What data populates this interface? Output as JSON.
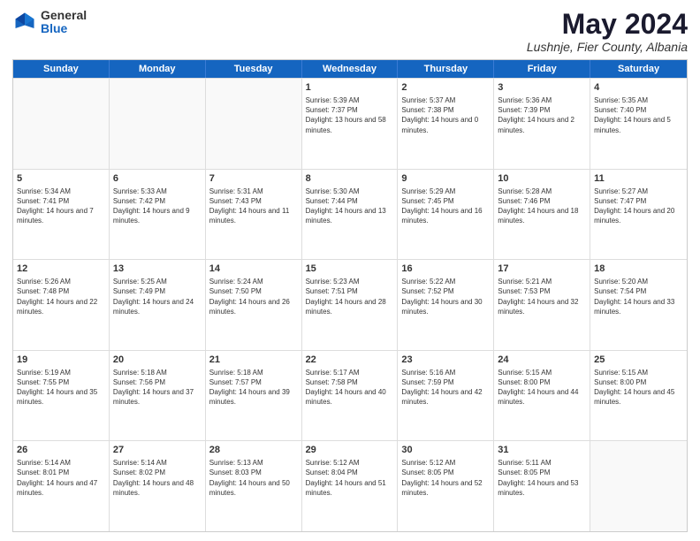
{
  "header": {
    "logo_line1": "General",
    "logo_line2": "Blue",
    "month_title": "May 2024",
    "location": "Lushnje, Fier County, Albania"
  },
  "weekdays": [
    "Sunday",
    "Monday",
    "Tuesday",
    "Wednesday",
    "Thursday",
    "Friday",
    "Saturday"
  ],
  "weeks": [
    [
      {
        "day": "",
        "empty": true
      },
      {
        "day": "",
        "empty": true
      },
      {
        "day": "",
        "empty": true
      },
      {
        "day": "1",
        "sunrise": "Sunrise: 5:39 AM",
        "sunset": "Sunset: 7:37 PM",
        "daylight": "Daylight: 13 hours and 58 minutes."
      },
      {
        "day": "2",
        "sunrise": "Sunrise: 5:37 AM",
        "sunset": "Sunset: 7:38 PM",
        "daylight": "Daylight: 14 hours and 0 minutes."
      },
      {
        "day": "3",
        "sunrise": "Sunrise: 5:36 AM",
        "sunset": "Sunset: 7:39 PM",
        "daylight": "Daylight: 14 hours and 2 minutes."
      },
      {
        "day": "4",
        "sunrise": "Sunrise: 5:35 AM",
        "sunset": "Sunset: 7:40 PM",
        "daylight": "Daylight: 14 hours and 5 minutes."
      }
    ],
    [
      {
        "day": "5",
        "sunrise": "Sunrise: 5:34 AM",
        "sunset": "Sunset: 7:41 PM",
        "daylight": "Daylight: 14 hours and 7 minutes."
      },
      {
        "day": "6",
        "sunrise": "Sunrise: 5:33 AM",
        "sunset": "Sunset: 7:42 PM",
        "daylight": "Daylight: 14 hours and 9 minutes."
      },
      {
        "day": "7",
        "sunrise": "Sunrise: 5:31 AM",
        "sunset": "Sunset: 7:43 PM",
        "daylight": "Daylight: 14 hours and 11 minutes."
      },
      {
        "day": "8",
        "sunrise": "Sunrise: 5:30 AM",
        "sunset": "Sunset: 7:44 PM",
        "daylight": "Daylight: 14 hours and 13 minutes."
      },
      {
        "day": "9",
        "sunrise": "Sunrise: 5:29 AM",
        "sunset": "Sunset: 7:45 PM",
        "daylight": "Daylight: 14 hours and 16 minutes."
      },
      {
        "day": "10",
        "sunrise": "Sunrise: 5:28 AM",
        "sunset": "Sunset: 7:46 PM",
        "daylight": "Daylight: 14 hours and 18 minutes."
      },
      {
        "day": "11",
        "sunrise": "Sunrise: 5:27 AM",
        "sunset": "Sunset: 7:47 PM",
        "daylight": "Daylight: 14 hours and 20 minutes."
      }
    ],
    [
      {
        "day": "12",
        "sunrise": "Sunrise: 5:26 AM",
        "sunset": "Sunset: 7:48 PM",
        "daylight": "Daylight: 14 hours and 22 minutes."
      },
      {
        "day": "13",
        "sunrise": "Sunrise: 5:25 AM",
        "sunset": "Sunset: 7:49 PM",
        "daylight": "Daylight: 14 hours and 24 minutes."
      },
      {
        "day": "14",
        "sunrise": "Sunrise: 5:24 AM",
        "sunset": "Sunset: 7:50 PM",
        "daylight": "Daylight: 14 hours and 26 minutes."
      },
      {
        "day": "15",
        "sunrise": "Sunrise: 5:23 AM",
        "sunset": "Sunset: 7:51 PM",
        "daylight": "Daylight: 14 hours and 28 minutes."
      },
      {
        "day": "16",
        "sunrise": "Sunrise: 5:22 AM",
        "sunset": "Sunset: 7:52 PM",
        "daylight": "Daylight: 14 hours and 30 minutes."
      },
      {
        "day": "17",
        "sunrise": "Sunrise: 5:21 AM",
        "sunset": "Sunset: 7:53 PM",
        "daylight": "Daylight: 14 hours and 32 minutes."
      },
      {
        "day": "18",
        "sunrise": "Sunrise: 5:20 AM",
        "sunset": "Sunset: 7:54 PM",
        "daylight": "Daylight: 14 hours and 33 minutes."
      }
    ],
    [
      {
        "day": "19",
        "sunrise": "Sunrise: 5:19 AM",
        "sunset": "Sunset: 7:55 PM",
        "daylight": "Daylight: 14 hours and 35 minutes."
      },
      {
        "day": "20",
        "sunrise": "Sunrise: 5:18 AM",
        "sunset": "Sunset: 7:56 PM",
        "daylight": "Daylight: 14 hours and 37 minutes."
      },
      {
        "day": "21",
        "sunrise": "Sunrise: 5:18 AM",
        "sunset": "Sunset: 7:57 PM",
        "daylight": "Daylight: 14 hours and 39 minutes."
      },
      {
        "day": "22",
        "sunrise": "Sunrise: 5:17 AM",
        "sunset": "Sunset: 7:58 PM",
        "daylight": "Daylight: 14 hours and 40 minutes."
      },
      {
        "day": "23",
        "sunrise": "Sunrise: 5:16 AM",
        "sunset": "Sunset: 7:59 PM",
        "daylight": "Daylight: 14 hours and 42 minutes."
      },
      {
        "day": "24",
        "sunrise": "Sunrise: 5:15 AM",
        "sunset": "Sunset: 8:00 PM",
        "daylight": "Daylight: 14 hours and 44 minutes."
      },
      {
        "day": "25",
        "sunrise": "Sunrise: 5:15 AM",
        "sunset": "Sunset: 8:00 PM",
        "daylight": "Daylight: 14 hours and 45 minutes."
      }
    ],
    [
      {
        "day": "26",
        "sunrise": "Sunrise: 5:14 AM",
        "sunset": "Sunset: 8:01 PM",
        "daylight": "Daylight: 14 hours and 47 minutes."
      },
      {
        "day": "27",
        "sunrise": "Sunrise: 5:14 AM",
        "sunset": "Sunset: 8:02 PM",
        "daylight": "Daylight: 14 hours and 48 minutes."
      },
      {
        "day": "28",
        "sunrise": "Sunrise: 5:13 AM",
        "sunset": "Sunset: 8:03 PM",
        "daylight": "Daylight: 14 hours and 50 minutes."
      },
      {
        "day": "29",
        "sunrise": "Sunrise: 5:12 AM",
        "sunset": "Sunset: 8:04 PM",
        "daylight": "Daylight: 14 hours and 51 minutes."
      },
      {
        "day": "30",
        "sunrise": "Sunrise: 5:12 AM",
        "sunset": "Sunset: 8:05 PM",
        "daylight": "Daylight: 14 hours and 52 minutes."
      },
      {
        "day": "31",
        "sunrise": "Sunrise: 5:11 AM",
        "sunset": "Sunset: 8:05 PM",
        "daylight": "Daylight: 14 hours and 53 minutes."
      },
      {
        "day": "",
        "empty": true
      }
    ]
  ]
}
